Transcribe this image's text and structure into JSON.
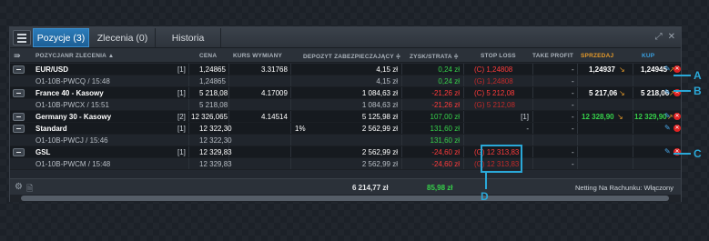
{
  "tabs": [
    {
      "label": "Pozycje (3)"
    },
    {
      "label": "Zlecenia (0)"
    },
    {
      "label": "Historia"
    }
  ],
  "columns": {
    "position": "POZYCJANR ZLECENIA ▲",
    "price": "CENA",
    "rate": "KURS WYMIANY",
    "margin": "DEPOZYT ZABEZPIECZAJĄCY ≑",
    "pnl": "ZYSK/STRATA ≑",
    "stop_loss": "STOP LOSS",
    "take_profit": "TAKE PROFIT",
    "sell": "SPRZEDAJ",
    "buy": "KUP"
  },
  "rows": [
    {
      "type": "main",
      "name": "EUR/USD",
      "count": "[1]",
      "price": "1,24865",
      "rate": "3.31768",
      "margin": "4,15 zł",
      "pnl": "0,24 zł",
      "stop_loss": "(C) 1,24808",
      "take_profit": "-",
      "sell": "1,24937",
      "buy": "1,24945"
    },
    {
      "type": "sub",
      "name": "O1-10B-PWCQ / 15:48",
      "price": "1,24865",
      "margin": "4,15 zł",
      "pnl": "0,24 zł",
      "stop_loss": "(G) 1,24808",
      "take_profit": "-"
    },
    {
      "type": "main",
      "name": "France 40 - Kasowy",
      "count": "[1]",
      "price": "5 218,08",
      "rate": "4.17009",
      "margin": "1 084,63 zł",
      "pnl": "-21,26 zł",
      "stop_loss": "(C) 5 212,08",
      "take_profit": "-",
      "sell": "5 217,06",
      "buy": "5 218,06"
    },
    {
      "type": "sub",
      "name": "O1-10B-PWCX / 15:51",
      "price": "5 218,08",
      "margin": "1 084,63 zł",
      "pnl": "-21,26 zł",
      "stop_loss": "(G) 5 212,08",
      "take_profit": "-"
    },
    {
      "type": "main",
      "name": "Germany 30 - Kasowy",
      "count": "[2]",
      "price": "12 326,065",
      "rate": "4.14514",
      "margin": "5 125,98 zł",
      "pnl": "107,00 zł",
      "stop_loss": "[1]",
      "take_profit": "-",
      "sell": "12 328,90",
      "buy": "12 329,90"
    },
    {
      "type": "main",
      "name": "Standard",
      "count": "[1]",
      "price": "12 322,30",
      "rate": "1%",
      "margin": "2 562,99 zł",
      "pnl": "131,60 zł",
      "stop_loss": "-",
      "take_profit": "-"
    },
    {
      "type": "sub",
      "name": "O1-10B-PWCJ / 15:46",
      "price": "12 322,30",
      "margin": "",
      "pnl": "131,60 zł",
      "stop_loss": "",
      "take_profit": ""
    },
    {
      "type": "main",
      "name": "GSL",
      "count": "[1]",
      "price": "12 329,83",
      "rate": "",
      "margin": "2 562,99 zł",
      "pnl": "-24,60 zł",
      "stop_loss": "(G) 12 313,83",
      "take_profit": "-"
    },
    {
      "type": "sub",
      "name": "O1-10B-PWCM / 15:48",
      "price": "12 329,83",
      "margin": "2 562,99 zł",
      "pnl": "-24,60 zł",
      "stop_loss": "(G) 12 313,83",
      "take_profit": "-"
    }
  ],
  "footer": {
    "margin_total": "6 214,77 zł",
    "pnl_total": "85,98 zł",
    "netting": "Netting Na Rachunku: Włączony"
  },
  "callouts": [
    "A",
    "B",
    "C",
    "D"
  ],
  "colors": {
    "accent": "#2aa8d8",
    "profit": "#36d14a",
    "loss": "#ff3b3b",
    "tab_active": "#2b7bb9"
  }
}
